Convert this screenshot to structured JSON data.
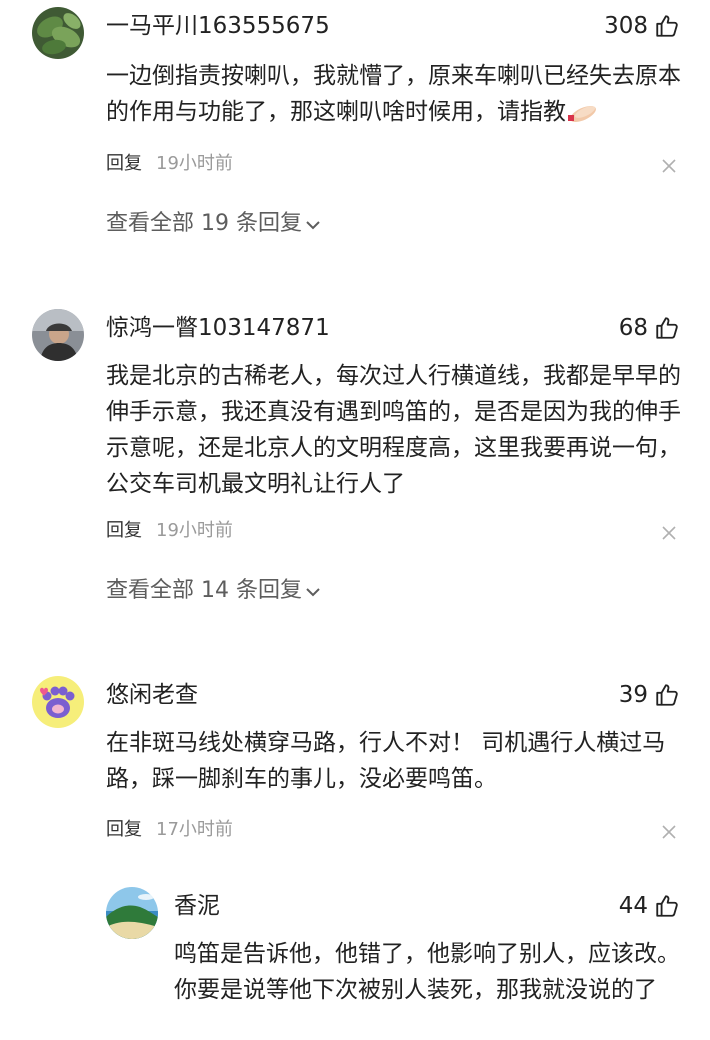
{
  "comments": [
    {
      "username": "一马平川163555675",
      "likes": "308",
      "text": "一边倒指责按喇叭，我就懵了，原来车喇叭已经失去原本的作用与功能了，那这喇叭啥时候用，请指教",
      "emoji": "praying-hands-emoji",
      "reply_label": "回复",
      "time": "19小时前",
      "view_all": "查看全部 19 条回复"
    },
    {
      "username": "惊鸿一瞥103147871",
      "likes": "68",
      "text": "我是北京的古稀老人，每次过人行横道线，我都是早早的伸手示意，我还真没有遇到鸣笛的，是否是因为我的伸手示意呢，还是北京人的文明程度高，这里我要再说一句，公交车司机最文明礼让行人了",
      "reply_label": "回复",
      "time": "19小时前",
      "view_all": "查看全部 14 条回复"
    },
    {
      "username": "悠闲老查",
      "likes": "39",
      "text": "在非斑马线处横穿马路，行人不对！ 司机遇行人横过马路，踩一脚刹车的事儿，没必要鸣笛。",
      "reply_label": "回复",
      "time": "17小时前"
    }
  ],
  "reply": {
    "username": "香泥",
    "likes": "44",
    "text": "鸣笛是告诉他，他错了，他影响了别人，应该改。你要是说等他下次被别人装死，那我就没说的了"
  },
  "icons": {
    "like": "thumbs-up-icon",
    "close": "close-icon",
    "chevron": "chevron-down-icon"
  }
}
